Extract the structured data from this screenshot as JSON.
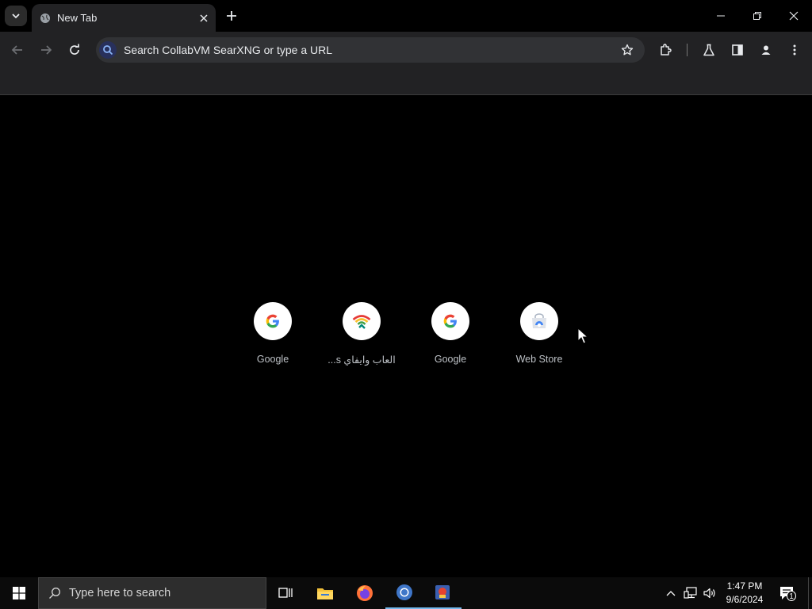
{
  "browser": {
    "tab": {
      "title": "New Tab"
    },
    "omnibox": {
      "placeholder": "Search CollabVM SearXNG or type a URL"
    }
  },
  "shortcuts": [
    {
      "label": "Google",
      "icon": "google-g-icon"
    },
    {
      "label": "العاب وايفاي s...",
      "icon": "wifi-rainbow-icon"
    },
    {
      "label": "Google",
      "icon": "google-g-icon"
    },
    {
      "label": "Web Store",
      "icon": "chrome-web-store-icon"
    }
  ],
  "taskbar": {
    "search_placeholder": "Type here to search",
    "time": "1:47 PM",
    "date": "9/6/2024",
    "notification_count": "1"
  },
  "colors": {
    "accent": "#8ab4f8",
    "taskbar_active": "#76b9ed",
    "toolbar_bg": "#222224",
    "omnibox_bg": "#313235"
  }
}
